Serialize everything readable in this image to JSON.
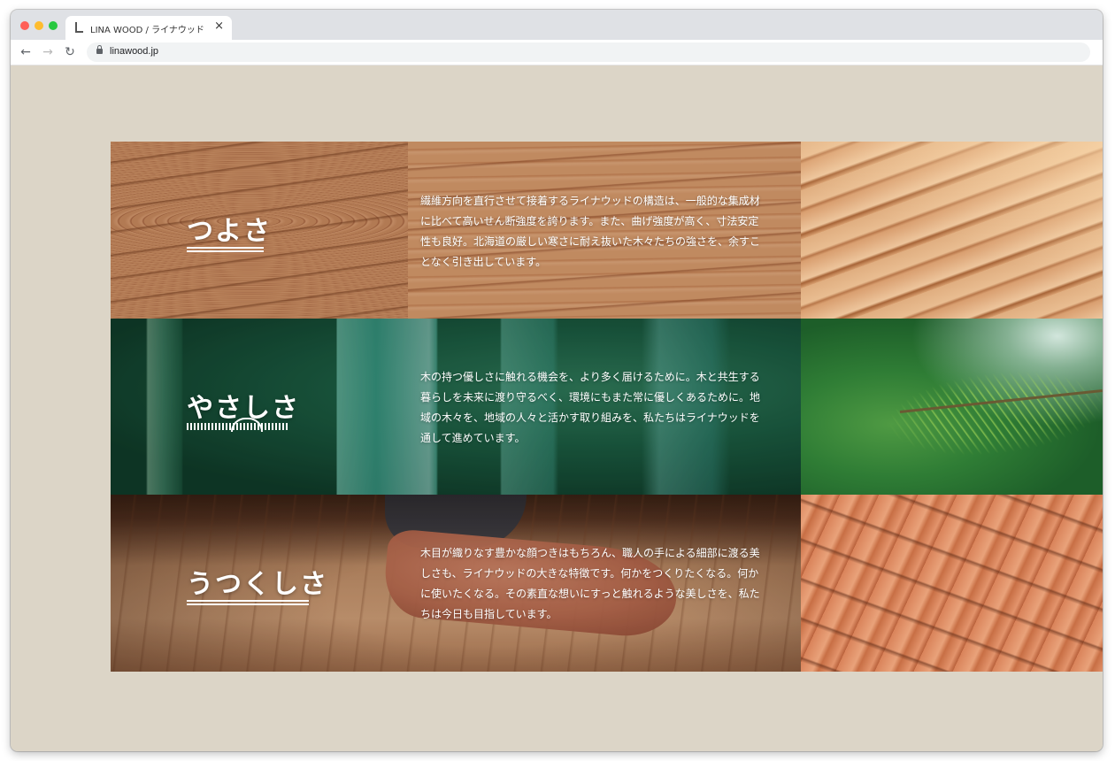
{
  "browser": {
    "tab_title": "LINA WOOD / ライナウッド",
    "tab_close": "×",
    "url": "linawood.jp",
    "icons": {
      "back": "arrow-left-icon",
      "forward": "arrow-right-icon",
      "reload": "reload-icon",
      "lock": "lock-icon",
      "favicon": "favicon-icon",
      "close": "close-icon"
    }
  },
  "page": {
    "background": "#dcd5c7",
    "panels": [
      {
        "heading": "つよさ",
        "text": "繊維方向を直行させて接着するライナウッドの構造は、一般的な集成材に比べて高いせん断強度を誇ります。また、曲げ強度が高く、寸法安定性も良好。北海道の厳しい寒さに耐え抜いた木々たちの強さを、余すことなく引き出しています。"
      },
      {
        "heading": "やさしさ",
        "text": "木の持つ優しさに触れる機会を、より多く届けるために。木と共生する暮らしを未来に渡り守るべく、環境にもまた常に優しくあるために。地域の木々を、地域の人々と活かす取り組みを、私たちはライナウッドを通して進めています。"
      },
      {
        "heading": "うつくしさ",
        "text": "木目が織りなす豊かな顔つきはもちろん、職人の手による細部に渡る美しさも、ライナウッドの大きな特徴です。何かをつくりたくなる。何かに使いたくなる。その素直な想いにすっと触れるような美しさを、私たちは今日も目指しています。"
      }
    ]
  }
}
